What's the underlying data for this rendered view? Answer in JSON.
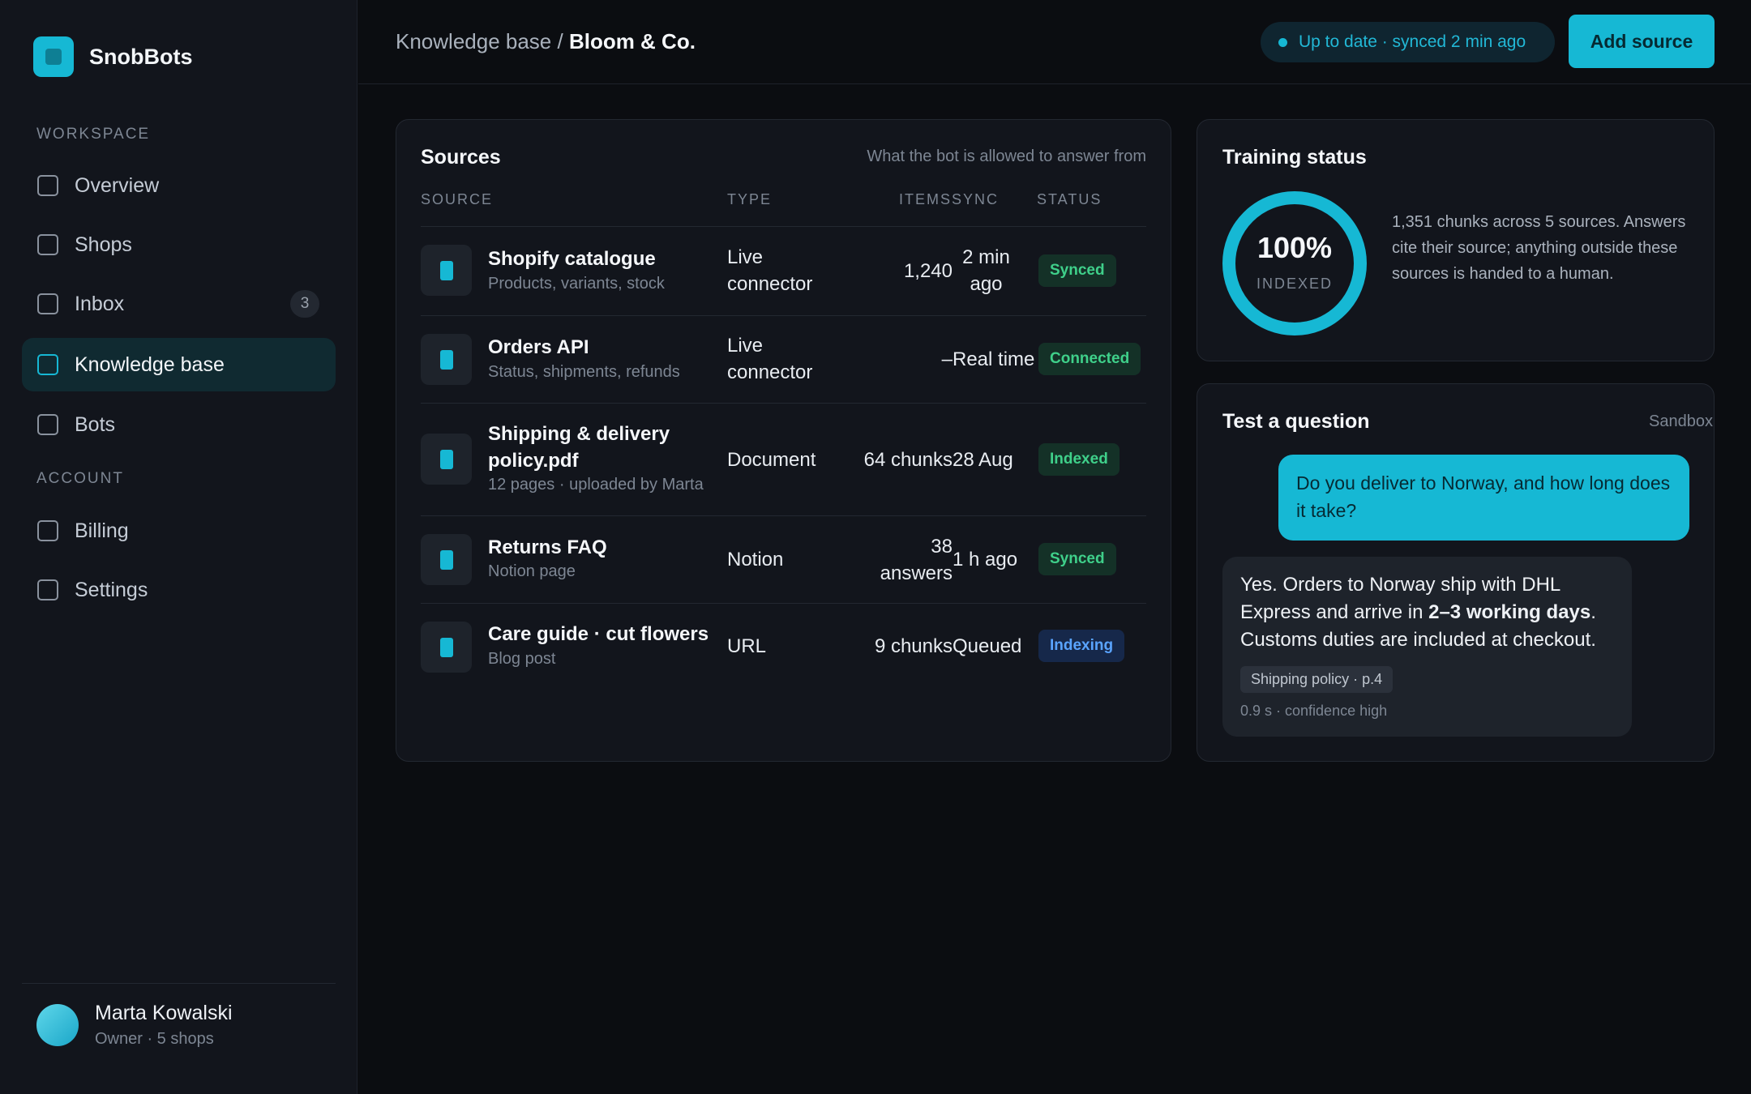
{
  "brand": {
    "name": "SnobBots"
  },
  "sidebar": {
    "section_workspace": "WORKSPACE",
    "section_account": "ACCOUNT",
    "items": [
      {
        "label": "Overview",
        "active": false
      },
      {
        "label": "Shops",
        "active": false
      },
      {
        "label": "Inbox",
        "active": false,
        "badge": "3"
      },
      {
        "label": "Knowledge base",
        "active": true
      },
      {
        "label": "Bots",
        "active": false
      },
      {
        "label": "Billing",
        "active": false
      },
      {
        "label": "Settings",
        "active": false
      }
    ]
  },
  "user": {
    "name": "Marta Kowalski",
    "role": "Owner · 5 shops"
  },
  "header": {
    "breadcrumb_parent": "Knowledge base /",
    "breadcrumb_current": "Bloom & Co.",
    "sync_status": "Up to date · synced 2 min ago",
    "add_label": "Add source"
  },
  "sources": {
    "title": "Sources",
    "hint": "What the bot is allowed to answer from",
    "columns": {
      "source": "SOURCE",
      "type": "TYPE",
      "items": "ITEMS",
      "sync": "SYNC",
      "status": "STATUS"
    },
    "rows": [
      {
        "name": "Shopify catalogue",
        "sub": "Products, variants, stock",
        "type": "Live connector",
        "items": "1,240",
        "sync": "2 min ago",
        "status": "Synced"
      },
      {
        "name": "Orders API",
        "sub": "Status, shipments, refunds",
        "type": "Live connector",
        "items": "–",
        "sync": "Real time",
        "status": "Connected"
      },
      {
        "name": "Shipping & delivery policy.pdf",
        "sub": "12 pages · uploaded by Marta",
        "type": "Document",
        "items": "64 chunks",
        "sync": "28 Aug",
        "status": "Indexed"
      },
      {
        "name": "Returns FAQ",
        "sub": "Notion page",
        "type": "Notion",
        "items": "38 answers",
        "sync": "1 h ago",
        "status": "Synced"
      },
      {
        "name": "Care guide · cut flowers",
        "sub": "Blog post",
        "type": "URL",
        "items": "9 chunks",
        "sync": "Queued",
        "status": "Indexing"
      }
    ]
  },
  "training": {
    "title": "Training status",
    "percent": "100%",
    "percent_value": 1.0,
    "label": "INDEXED",
    "description": "1,351 chunks across 5 sources. Answers cite their source; anything outside these sources is handed to a human."
  },
  "test": {
    "title": "Test a question",
    "mode": "Sandbox",
    "question": "Do you deliver to Norway, and how long does it take?",
    "answer_part1": "Yes. Orders to Norway ship with DHL Express and arrive in ",
    "answer_bold": "2–3 working days",
    "answer_part2": ". Customs duties are included at checkout.",
    "citation": "Shipping policy · p.4",
    "meta": "0.9 s · confidence high"
  },
  "colors": {
    "accent": "#16b8d4",
    "synced": "#3fd08a",
    "indexing": "#5aa4ff"
  }
}
